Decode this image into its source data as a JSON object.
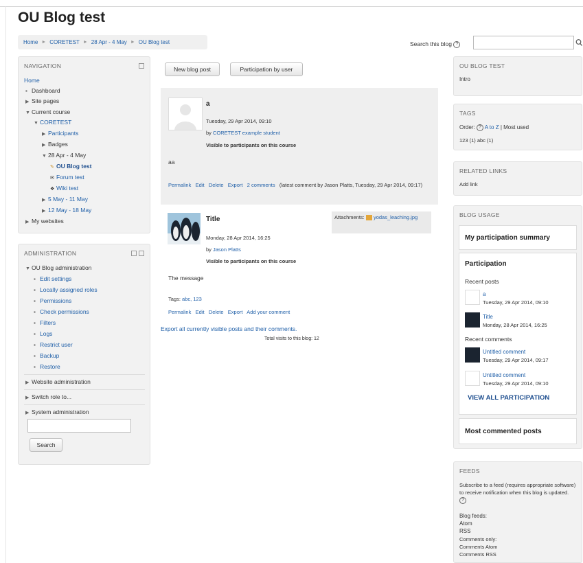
{
  "page_title": "OU Blog test",
  "breadcrumb": [
    "Home",
    "CORETEST",
    "28 Apr - 4 May",
    "OU Blog test"
  ],
  "search": {
    "label": "Search this blog",
    "placeholder": ""
  },
  "navigation": {
    "title": "NAVIGATION",
    "items": {
      "home": "Home",
      "dashboard": "Dashboard",
      "site_pages": "Site pages",
      "current_course": "Current course",
      "coretest": "CORETEST",
      "participants": "Participants",
      "badges": "Badges",
      "week1": "28 Apr - 4 May",
      "ou_blog_test": "OU Blog test",
      "forum_test": "Forum test",
      "wiki_test": "Wiki test",
      "week2": "5 May - 11 May",
      "week3": "12 May - 18 May",
      "my_websites": "My websites"
    }
  },
  "administration": {
    "title": "ADMINISTRATION",
    "ou_blog_admin": "OU Blog administration",
    "items": [
      "Edit settings",
      "Locally assigned roles",
      "Permissions",
      "Check permissions",
      "Filters",
      "Logs",
      "Restrict user",
      "Backup",
      "Restore"
    ],
    "website_admin": "Website administration",
    "switch_role": "Switch role to...",
    "system_admin": "System administration",
    "search_button": "Search"
  },
  "toolbar": {
    "new_post": "New blog post",
    "participation": "Participation by user"
  },
  "posts": [
    {
      "title": "a",
      "date": "Tuesday, 29 Apr 2014, 09:10",
      "by_prefix": "by",
      "author": "CORETEST example student",
      "visibility": "Visible to participants on this course",
      "body": "aa",
      "actions": [
        "Permalink",
        "Edit",
        "Delete",
        "Export",
        "2 comments"
      ],
      "latest_comment": "(latest comment by Jason Platts, Tuesday, 29 Apr 2014, 09:17)"
    },
    {
      "title": "Title",
      "date": "Monday, 28 Apr 2014, 16:25",
      "by_prefix": "by",
      "author": "Jason Platts",
      "visibility": "Visible to participants on this course",
      "attachments_label": "Attachments:",
      "attachment_file": "yodas_leaching.jpg",
      "body": "The message",
      "tags_label": "Tags:",
      "tags": "abc, 123",
      "actions": [
        "Permalink",
        "Edit",
        "Delete",
        "Export",
        "Add your comment"
      ]
    }
  ],
  "export_all": "Export all currently visible posts and their comments.",
  "total_visits": "Total visits to this blog: 12",
  "ou_blog_block": {
    "title": "OU BLOG TEST",
    "intro": "Intro"
  },
  "tags_block": {
    "title": "TAGS",
    "order_label": "Order:",
    "az": "A to Z",
    "sep": "|",
    "most_used": "Most used",
    "tags": "123 (1) abc (1)"
  },
  "related_links": {
    "title": "RELATED LINKS",
    "add_link": "Add link"
  },
  "blog_usage": {
    "title": "BLOG USAGE",
    "summary_heading": "My participation summary",
    "participation_heading": "Participation",
    "recent_posts_label": "Recent posts",
    "recent_posts": [
      {
        "title": "a",
        "date": "Tuesday, 29 Apr 2014, 09:10"
      },
      {
        "title": "Title",
        "date": "Monday, 28 Apr 2014, 16:25"
      }
    ],
    "recent_comments_label": "Recent comments",
    "recent_comments": [
      {
        "title": "Untitled comment",
        "date": "Tuesday, 29 Apr 2014, 09:17"
      },
      {
        "title": "Untitled comment",
        "date": "Tuesday, 29 Apr 2014, 09:10"
      }
    ],
    "view_all": "VIEW ALL PARTICIPATION",
    "most_commented": "Most commented posts"
  },
  "feeds": {
    "title": "FEEDS",
    "description": "Subscribe to a feed (requires appropriate software) to receive notification when this blog is updated.",
    "blog_feeds": "Blog feeds:",
    "atom": "Atom",
    "rss": "RSS",
    "comments_only": "Comments only:",
    "comments_atom": "Comments Atom",
    "comments_rss": "Comments RSS"
  }
}
